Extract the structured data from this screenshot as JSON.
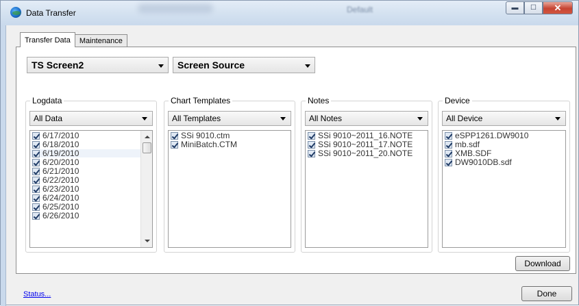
{
  "window": {
    "title": "Data Transfer",
    "blurred_text": "Default"
  },
  "tabs": [
    {
      "label": "Transfer Data",
      "active": true
    },
    {
      "label": "Maintenance",
      "active": false
    }
  ],
  "screen_select": {
    "value": "TS Screen2"
  },
  "source_select": {
    "value": "Screen Source"
  },
  "groups": {
    "logdata": {
      "label": "Logdata",
      "filter": "All Data",
      "items": [
        "6/17/2010",
        "6/18/2010",
        "6/19/2010",
        "6/20/2010",
        "6/21/2010",
        "6/22/2010",
        "6/23/2010",
        "6/24/2010",
        "6/25/2010",
        "6/26/2010"
      ]
    },
    "chart_templates": {
      "label": "Chart Templates",
      "filter": "All Templates",
      "items": [
        "SSi 9010.ctm",
        "MiniBatch.CTM"
      ]
    },
    "notes": {
      "label": "Notes",
      "filter": "All Notes",
      "items": [
        "SSi 9010~2011_16.NOTE",
        "SSi 9010~2011_17.NOTE",
        "SSi 9010~2011_20.NOTE"
      ]
    },
    "device": {
      "label": "Device",
      "filter": "All Device",
      "items": [
        "eSPP1261.DW9010",
        "mb.sdf",
        "XMB.SDF",
        "DW9010DB.sdf"
      ]
    }
  },
  "buttons": {
    "download": "Download",
    "done": "Done"
  },
  "status_link": "Status...",
  "icons": {
    "app": "globe-icon",
    "minimize": "minimize-icon",
    "maximize": "maximize-icon",
    "close": "close-icon",
    "dropdown": "chevron-down-icon",
    "checkbox": "checkbox-checked-icon"
  }
}
